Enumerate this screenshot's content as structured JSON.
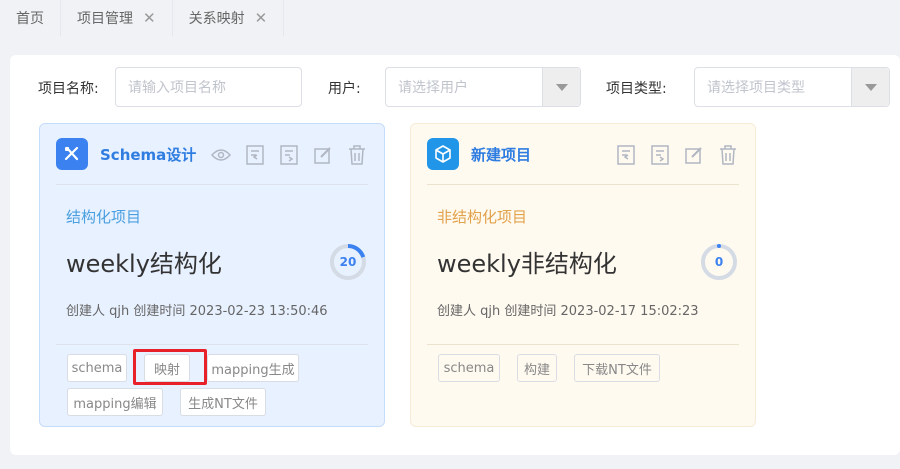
{
  "tabs": [
    {
      "label": "首页"
    },
    {
      "label": "项目管理"
    },
    {
      "label": "关系映射"
    }
  ],
  "filters": {
    "name_label": "项目名称:",
    "name_placeholder": "请输入项目名称",
    "user_label": "用户:",
    "user_placeholder": "请选择用户",
    "type_label": "项目类型:",
    "type_placeholder": "请选择项目类型"
  },
  "cards": [
    {
      "title": "Schema设计",
      "type": "结构化项目",
      "type_color": "#4a9fe0",
      "name": "weekly结构化",
      "progress": 20,
      "progress_label": "20",
      "creator": "创建人 qjh   创建时间 2023-02-23 13:50:46",
      "tags": [
        "schema",
        "映射",
        "mapping生成",
        "mapping编辑",
        "生成NT文件"
      ]
    },
    {
      "title": "新建项目",
      "type": "非结构化项目",
      "type_color": "#e2a14b",
      "name": "weekly非结构化",
      "progress": 0,
      "progress_label": "0",
      "creator": "创建人 qjh   创建时间 2023-02-17 15:02:23",
      "tags": [
        "schema",
        "构建",
        "下载NT文件"
      ]
    }
  ],
  "colors": {
    "accent": "#2f7de1",
    "highlight": "#e8202a"
  }
}
